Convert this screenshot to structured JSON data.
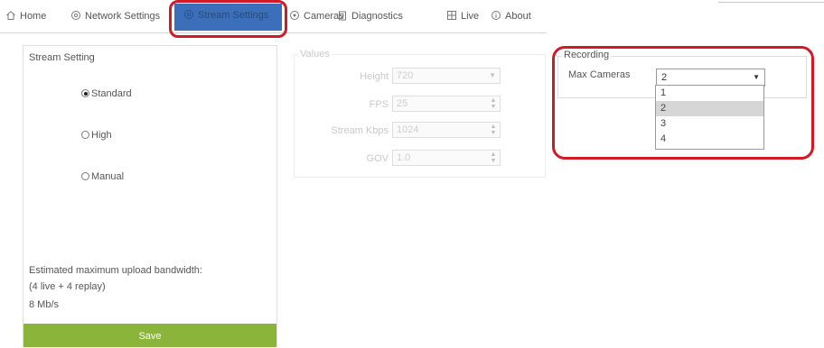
{
  "nav": {
    "items": [
      {
        "label": "Home",
        "icon": "home-icon"
      },
      {
        "label": "Network Settings",
        "icon": "network-gear-icon"
      },
      {
        "label": "Stream Settings",
        "icon": "stream-settings-icon",
        "active": true
      },
      {
        "label": "Cameras",
        "icon": "camera-icon"
      },
      {
        "label": "Diagnostics",
        "icon": "clipboard-icon"
      },
      {
        "label": "Live",
        "icon": "live-grid-icon"
      },
      {
        "label": "About",
        "icon": "info-icon"
      }
    ]
  },
  "stream_setting": {
    "legend": "Stream Setting",
    "options": [
      {
        "label": "Standard",
        "selected": true
      },
      {
        "label": "High",
        "selected": false
      },
      {
        "label": "Manual",
        "selected": false
      }
    ],
    "bandwidth_label": "Estimated maximum upload bandwidth:",
    "bandwidth_detail": "(4 live + 4 replay)",
    "bandwidth_value": "8 Mb/s",
    "save_label": "Save"
  },
  "values": {
    "legend": "Values",
    "fields": [
      {
        "label": "Height",
        "value": "720"
      },
      {
        "label": "FPS",
        "value": "25"
      },
      {
        "label": "Stream Kbps",
        "value": "1024"
      },
      {
        "label": "GOV",
        "value": "1.0"
      }
    ]
  },
  "recording": {
    "legend": "Recording",
    "max_cameras_label": "Max Cameras",
    "selected_value": "2",
    "options": [
      "1",
      "2",
      "3",
      "4"
    ],
    "highlighted_option": "2"
  },
  "colors": {
    "active_tab": "#3c6fb9",
    "save_button": "#8bb53a",
    "annotation": "#d11a26"
  }
}
